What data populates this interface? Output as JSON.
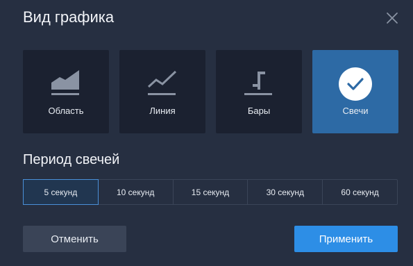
{
  "dialog": {
    "title": "Вид графика"
  },
  "chart_types": [
    {
      "label": "Область",
      "icon": "area-chart-icon",
      "selected": false
    },
    {
      "label": "Линия",
      "icon": "line-chart-icon",
      "selected": false
    },
    {
      "label": "Бары",
      "icon": "bar-chart-icon",
      "selected": false
    },
    {
      "label": "Свечи",
      "icon": "check-icon",
      "selected": true
    }
  ],
  "period": {
    "title": "Период свечей",
    "options": [
      {
        "label": "5 секунд",
        "active": true
      },
      {
        "label": "10 секунд",
        "active": false
      },
      {
        "label": "15 секунд",
        "active": false
      },
      {
        "label": "30 секунд",
        "active": false
      },
      {
        "label": "60 секунд",
        "active": false
      }
    ]
  },
  "actions": {
    "cancel_label": "Отменить",
    "apply_label": "Применить"
  },
  "colors": {
    "dialog_bg": "#262f41",
    "card_bg": "#1b2130",
    "selected_card_bg": "#2d6aa5",
    "accent": "#2d8ee6",
    "icon_gray": "#8a93a3"
  }
}
